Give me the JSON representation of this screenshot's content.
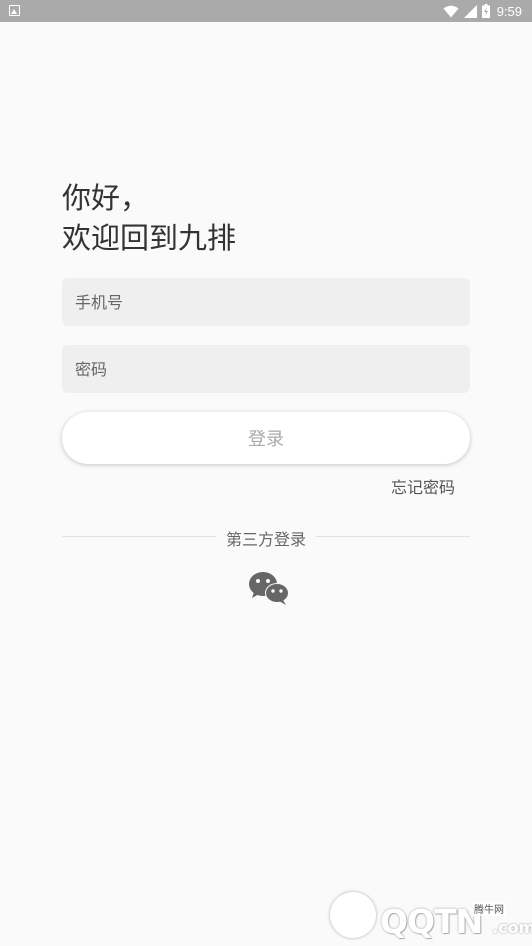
{
  "status_bar": {
    "time": "9:59",
    "icons": [
      "notification-icon",
      "wifi-icon",
      "signal-icon",
      "battery-charging-icon"
    ]
  },
  "greeting": {
    "line1": "你好，",
    "line2": "欢迎回到九排"
  },
  "form": {
    "phone_placeholder": "手机号",
    "password_placeholder": "密码",
    "login_label": "登录",
    "forgot_label": "忘记密码"
  },
  "third_party": {
    "label": "第三方登录",
    "icons": [
      "wechat-icon"
    ]
  },
  "watermark": {
    "brand": "QQTN",
    "suffix": ".com",
    "tag": "腾牛网"
  },
  "colors": {
    "background": "#fafafa",
    "status_bar": "#aaaaaa",
    "field_background": "#efefef",
    "button_text": "#aaaaaa"
  }
}
